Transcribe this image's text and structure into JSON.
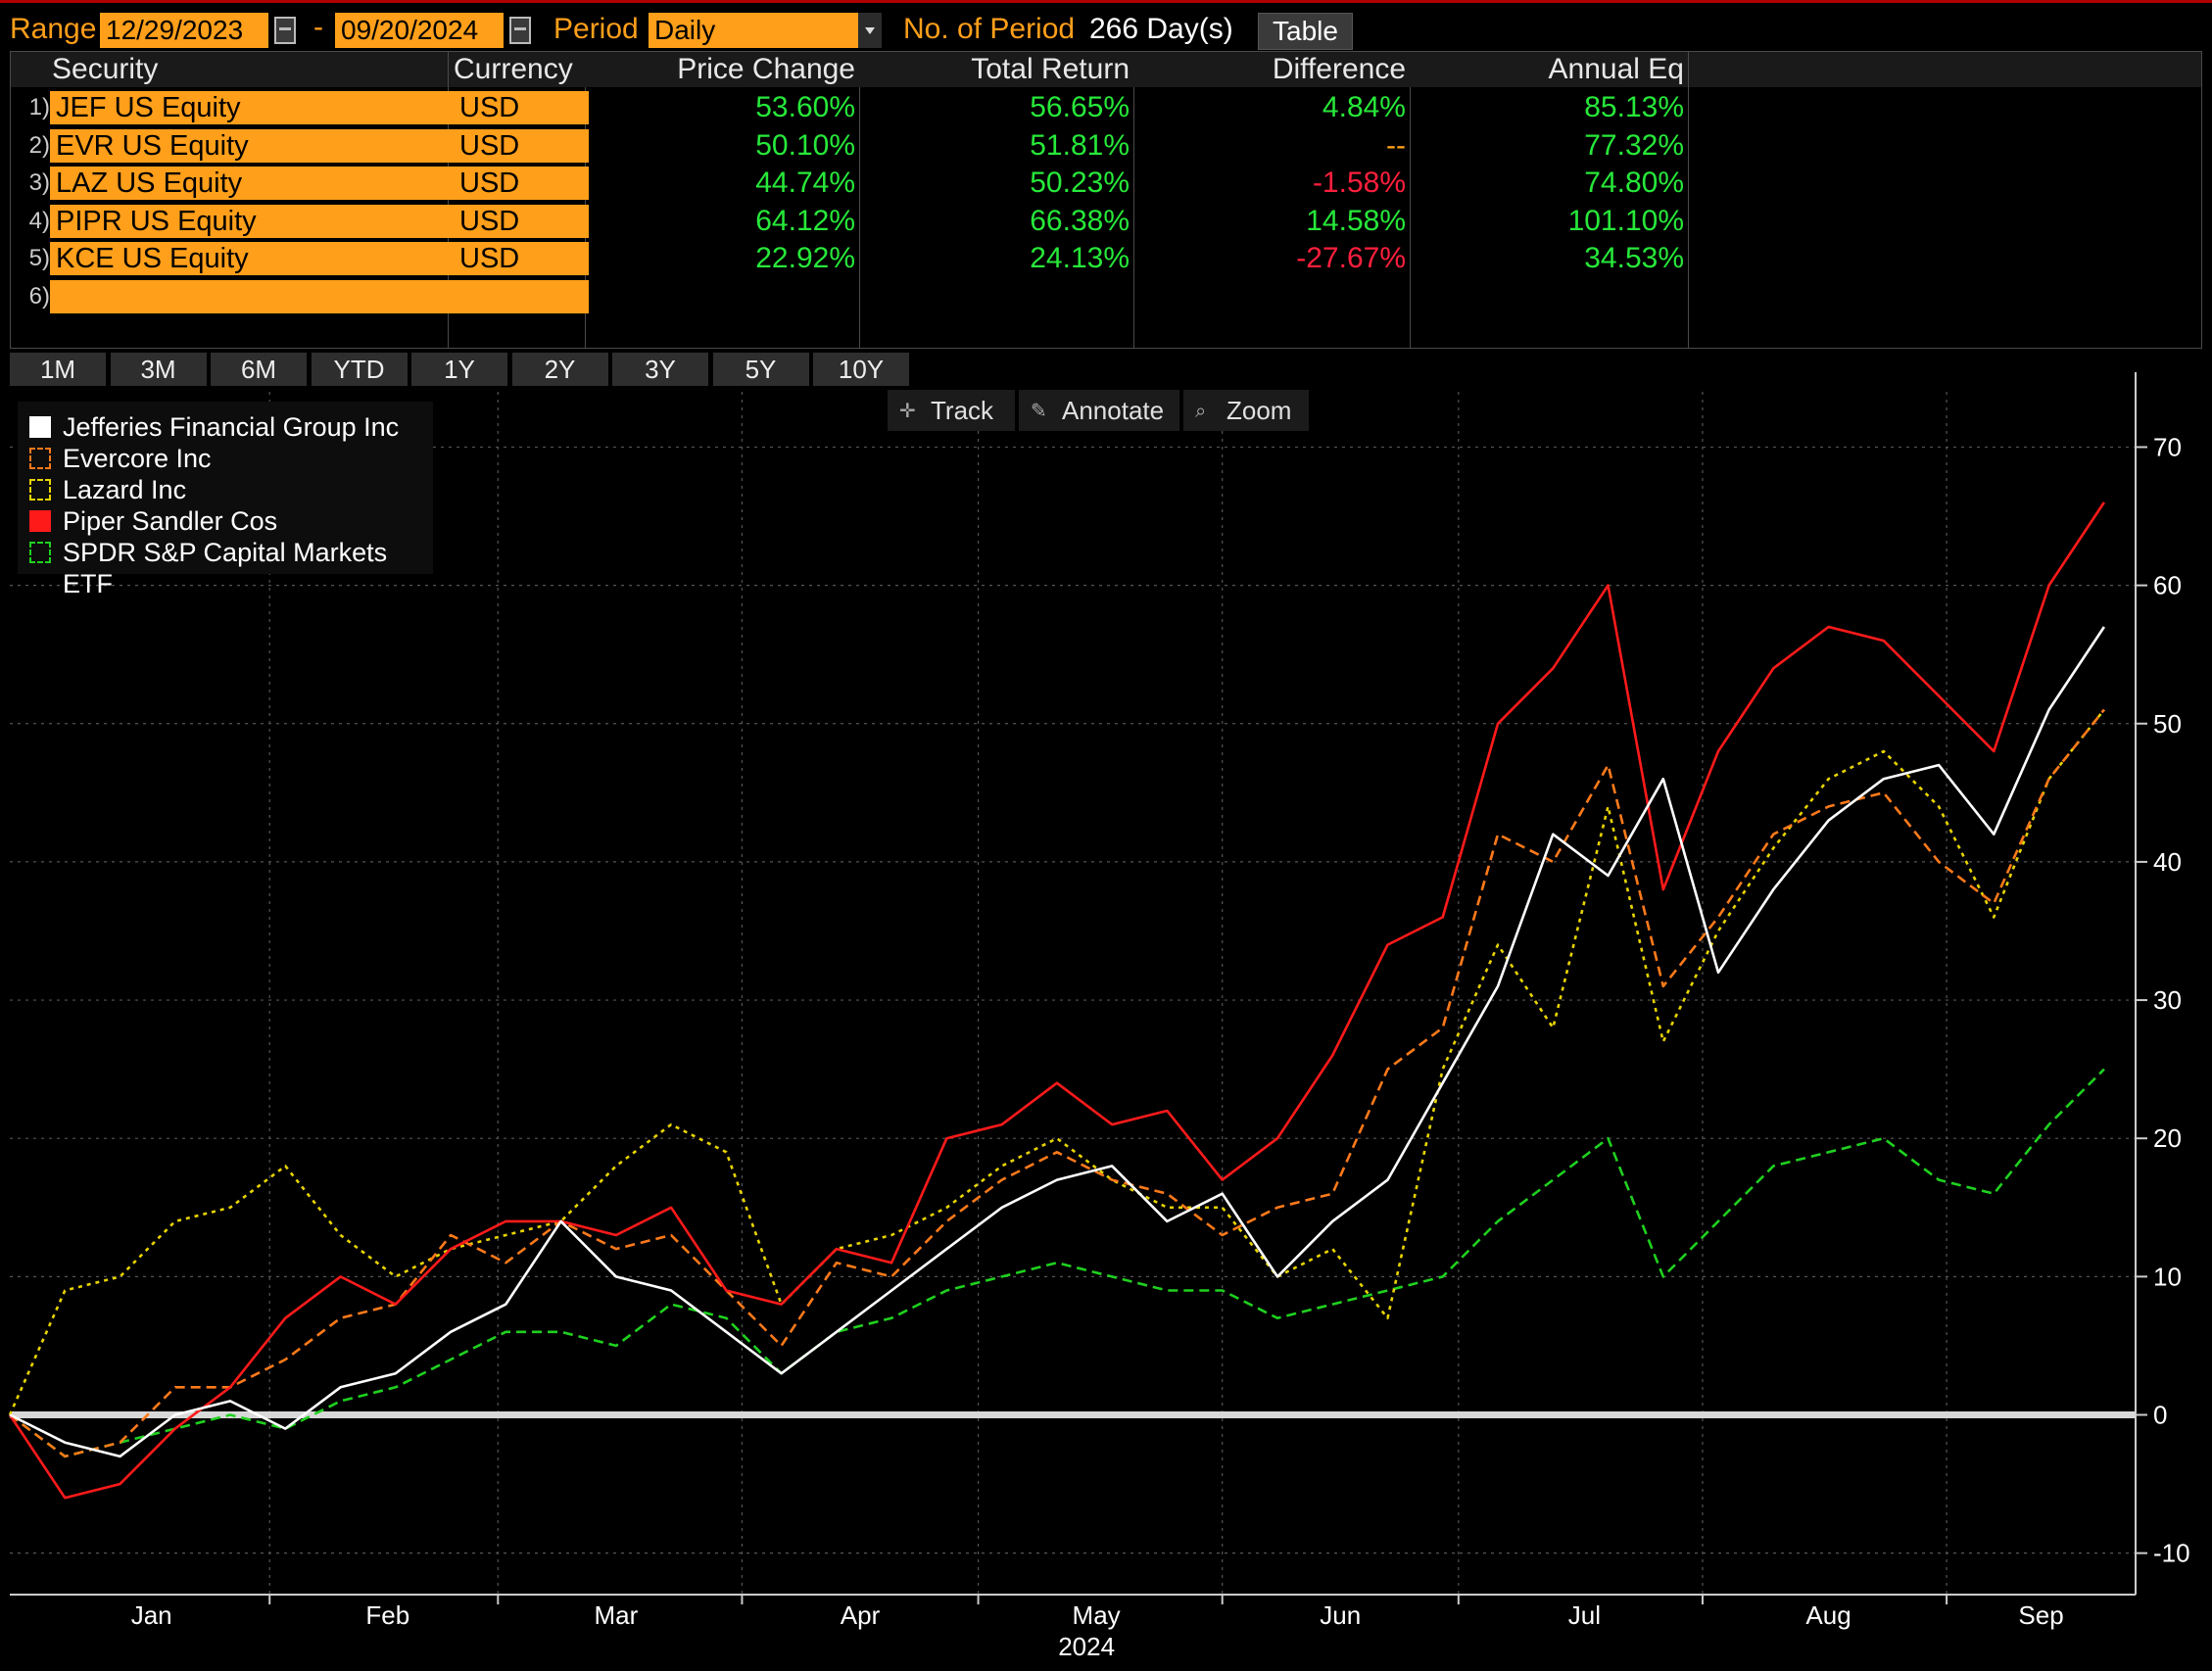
{
  "header": {
    "range_label": "Range",
    "start_date": "12/29/2023",
    "dash": "-",
    "end_date": "09/20/2024",
    "period_label": "Period",
    "period_value": "Daily",
    "num_period_label": "No. of Period",
    "num_period_value": "266 Day(s)",
    "table_button": "Table"
  },
  "table": {
    "columns": [
      "Security",
      "Currency",
      "Price Change",
      "Total Return",
      "Difference",
      "Annual Eq"
    ],
    "rows": [
      {
        "num": "1)",
        "security": "JEF US Equity",
        "currency": "USD",
        "price_change": "53.60%",
        "total_return": "56.65%",
        "difference": "4.84%",
        "diff_sign": "pos",
        "annual_eq": "85.13%"
      },
      {
        "num": "2)",
        "security": "EVR US Equity",
        "currency": "USD",
        "price_change": "50.10%",
        "total_return": "51.81%",
        "difference": "--",
        "diff_sign": "neu",
        "annual_eq": "77.32%"
      },
      {
        "num": "3)",
        "security": "LAZ US Equity",
        "currency": "USD",
        "price_change": "44.74%",
        "total_return": "50.23%",
        "difference": "-1.58%",
        "diff_sign": "neg",
        "annual_eq": "74.80%"
      },
      {
        "num": "4)",
        "security": "PIPR US Equity",
        "currency": "USD",
        "price_change": "64.12%",
        "total_return": "66.38%",
        "difference": "14.58%",
        "diff_sign": "pos",
        "annual_eq": "101.10%"
      },
      {
        "num": "5)",
        "security": "KCE US Equity",
        "currency": "USD",
        "price_change": "22.92%",
        "total_return": "24.13%",
        "difference": "-27.67%",
        "diff_sign": "neg",
        "annual_eq": "34.53%"
      },
      {
        "num": "6)",
        "security": "",
        "currency": "",
        "price_change": "",
        "total_return": "",
        "difference": "",
        "diff_sign": "neu",
        "annual_eq": ""
      }
    ]
  },
  "period_tabs": [
    "1M",
    "3M",
    "6M",
    "YTD",
    "1Y",
    "2Y",
    "3Y",
    "5Y",
    "10Y"
  ],
  "tools": [
    {
      "label": "Track",
      "icon": "crosshair-icon"
    },
    {
      "label": "Annotate",
      "icon": "pencil-icon"
    },
    {
      "label": "Zoom",
      "icon": "magnifier-icon"
    }
  ],
  "chart_data": {
    "type": "line",
    "ylim": [
      -13,
      74
    ],
    "yticks": [
      -10,
      0,
      10,
      20,
      30,
      40,
      50,
      60,
      70
    ],
    "ytick_labels": [
      "-10",
      "0",
      "10",
      "20",
      "30",
      "40",
      "50",
      "60",
      "70"
    ],
    "xlim": [
      "2023-12-29",
      "2024-09-24"
    ],
    "month_labels": [
      {
        "label": "Jan",
        "date": "2024-01-16"
      },
      {
        "label": "Feb",
        "date": "2024-02-15"
      },
      {
        "label": "Mar",
        "date": "2024-03-15"
      },
      {
        "label": "Apr",
        "date": "2024-04-15"
      },
      {
        "label": "May",
        "date": "2024-05-15"
      },
      {
        "label": "Jun",
        "date": "2024-06-15"
      },
      {
        "label": "Jul",
        "date": "2024-07-16"
      },
      {
        "label": "Aug",
        "date": "2024-08-16"
      },
      {
        "label": "Sep",
        "date": "2024-09-12"
      }
    ],
    "month_boundaries": [
      "2024-01-31",
      "2024-02-29",
      "2024-03-31",
      "2024-04-30",
      "2024-05-31",
      "2024-06-30",
      "2024-07-31",
      "2024-08-31"
    ],
    "year_label": "2024",
    "zero_line": 0,
    "grid": true,
    "legend_position": "top-left",
    "series": [
      {
        "name": "Jefferies Financial Group Inc",
        "color": "#ffffff",
        "dash": "solid",
        "swatch": "filled",
        "x": [
          "2023-12-29",
          "2024-01-05",
          "2024-01-12",
          "2024-01-19",
          "2024-01-26",
          "2024-02-02",
          "2024-02-09",
          "2024-02-16",
          "2024-02-23",
          "2024-03-01",
          "2024-03-08",
          "2024-03-15",
          "2024-03-22",
          "2024-03-29",
          "2024-04-05",
          "2024-04-12",
          "2024-04-19",
          "2024-04-26",
          "2024-05-03",
          "2024-05-10",
          "2024-05-17",
          "2024-05-24",
          "2024-05-31",
          "2024-06-07",
          "2024-06-14",
          "2024-06-21",
          "2024-06-28",
          "2024-07-05",
          "2024-07-12",
          "2024-07-19",
          "2024-07-26",
          "2024-08-02",
          "2024-08-09",
          "2024-08-16",
          "2024-08-23",
          "2024-08-30",
          "2024-09-06",
          "2024-09-13",
          "2024-09-20"
        ],
        "y": [
          0,
          -2,
          -3,
          0,
          1,
          -1,
          2,
          3,
          6,
          8,
          14,
          10,
          9,
          6,
          3,
          6,
          9,
          12,
          15,
          17,
          18,
          14,
          16,
          10,
          14,
          17,
          24,
          31,
          42,
          39,
          46,
          32,
          38,
          43,
          46,
          47,
          42,
          51,
          57
        ]
      },
      {
        "name": "Evercore Inc",
        "color": "#ff7a1a",
        "dash": "dashed",
        "swatch": "outline",
        "x": [
          "2023-12-29",
          "2024-01-05",
          "2024-01-12",
          "2024-01-19",
          "2024-01-26",
          "2024-02-02",
          "2024-02-09",
          "2024-02-16",
          "2024-02-23",
          "2024-03-01",
          "2024-03-08",
          "2024-03-15",
          "2024-03-22",
          "2024-03-29",
          "2024-04-05",
          "2024-04-12",
          "2024-04-19",
          "2024-04-26",
          "2024-05-03",
          "2024-05-10",
          "2024-05-17",
          "2024-05-24",
          "2024-05-31",
          "2024-06-07",
          "2024-06-14",
          "2024-06-21",
          "2024-06-28",
          "2024-07-05",
          "2024-07-12",
          "2024-07-19",
          "2024-07-26",
          "2024-08-02",
          "2024-08-09",
          "2024-08-16",
          "2024-08-23",
          "2024-08-30",
          "2024-09-06",
          "2024-09-13",
          "2024-09-20"
        ],
        "y": [
          0,
          -3,
          -2,
          2,
          2,
          4,
          7,
          8,
          13,
          11,
          14,
          12,
          13,
          9,
          5,
          11,
          10,
          14,
          17,
          19,
          17,
          16,
          13,
          15,
          16,
          25,
          28,
          42,
          40,
          47,
          31,
          36,
          42,
          44,
          45,
          40,
          37,
          46,
          51
        ]
      },
      {
        "name": "Lazard Inc",
        "color": "#e8d400",
        "dash": "dotted",
        "swatch": "outline",
        "x": [
          "2023-12-29",
          "2024-01-05",
          "2024-01-12",
          "2024-01-19",
          "2024-01-26",
          "2024-02-02",
          "2024-02-09",
          "2024-02-16",
          "2024-02-23",
          "2024-03-01",
          "2024-03-08",
          "2024-03-15",
          "2024-03-22",
          "2024-03-29",
          "2024-04-05",
          "2024-04-12",
          "2024-04-19",
          "2024-04-26",
          "2024-05-03",
          "2024-05-10",
          "2024-05-17",
          "2024-05-24",
          "2024-05-31",
          "2024-06-07",
          "2024-06-14",
          "2024-06-21",
          "2024-06-28",
          "2024-07-05",
          "2024-07-12",
          "2024-07-19",
          "2024-07-26",
          "2024-08-02",
          "2024-08-09",
          "2024-08-16",
          "2024-08-23",
          "2024-08-30",
          "2024-09-06",
          "2024-09-13",
          "2024-09-20"
        ],
        "y": [
          0,
          9,
          10,
          14,
          15,
          18,
          13,
          10,
          12,
          13,
          14,
          18,
          21,
          19,
          8,
          12,
          13,
          15,
          18,
          20,
          17,
          15,
          15,
          10,
          12,
          7,
          25,
          34,
          28,
          44,
          27,
          35,
          41,
          46,
          48,
          44,
          36,
          46,
          51
        ]
      },
      {
        "name": "Piper Sandler Cos",
        "color": "#ff1a1a",
        "dash": "solid",
        "swatch": "filled",
        "x": [
          "2023-12-29",
          "2024-01-05",
          "2024-01-12",
          "2024-01-19",
          "2024-01-26",
          "2024-02-02",
          "2024-02-09",
          "2024-02-16",
          "2024-02-23",
          "2024-03-01",
          "2024-03-08",
          "2024-03-15",
          "2024-03-22",
          "2024-03-29",
          "2024-04-05",
          "2024-04-12",
          "2024-04-19",
          "2024-04-26",
          "2024-05-03",
          "2024-05-10",
          "2024-05-17",
          "2024-05-24",
          "2024-05-31",
          "2024-06-07",
          "2024-06-14",
          "2024-06-21",
          "2024-06-28",
          "2024-07-05",
          "2024-07-12",
          "2024-07-19",
          "2024-07-26",
          "2024-08-02",
          "2024-08-09",
          "2024-08-16",
          "2024-08-23",
          "2024-08-30",
          "2024-09-06",
          "2024-09-13",
          "2024-09-20"
        ],
        "y": [
          0,
          -6,
          -5,
          -1,
          2,
          7,
          10,
          8,
          12,
          14,
          14,
          13,
          15,
          9,
          8,
          12,
          11,
          20,
          21,
          24,
          21,
          22,
          17,
          20,
          26,
          34,
          36,
          50,
          54,
          60,
          38,
          48,
          54,
          57,
          56,
          52,
          48,
          60,
          66
        ]
      },
      {
        "name": "SPDR S&P Capital Markets ETF",
        "color": "#1fd11f",
        "dash": "dashed",
        "swatch": "outline",
        "x": [
          "2023-12-29",
          "2024-01-05",
          "2024-01-12",
          "2024-01-19",
          "2024-01-26",
          "2024-02-02",
          "2024-02-09",
          "2024-02-16",
          "2024-02-23",
          "2024-03-01",
          "2024-03-08",
          "2024-03-15",
          "2024-03-22",
          "2024-03-29",
          "2024-04-05",
          "2024-04-12",
          "2024-04-19",
          "2024-04-26",
          "2024-05-03",
          "2024-05-10",
          "2024-05-17",
          "2024-05-24",
          "2024-05-31",
          "2024-06-07",
          "2024-06-14",
          "2024-06-21",
          "2024-06-28",
          "2024-07-05",
          "2024-07-12",
          "2024-07-19",
          "2024-07-26",
          "2024-08-02",
          "2024-08-09",
          "2024-08-16",
          "2024-08-23",
          "2024-08-30",
          "2024-09-06",
          "2024-09-13",
          "2024-09-20"
        ],
        "y": [
          0,
          -3,
          -2,
          -1,
          0,
          -1,
          1,
          2,
          4,
          6,
          6,
          5,
          8,
          7,
          3,
          6,
          7,
          9,
          10,
          11,
          10,
          9,
          9,
          7,
          8,
          9,
          10,
          14,
          17,
          20,
          10,
          14,
          18,
          19,
          20,
          17,
          16,
          21,
          25
        ]
      }
    ]
  }
}
